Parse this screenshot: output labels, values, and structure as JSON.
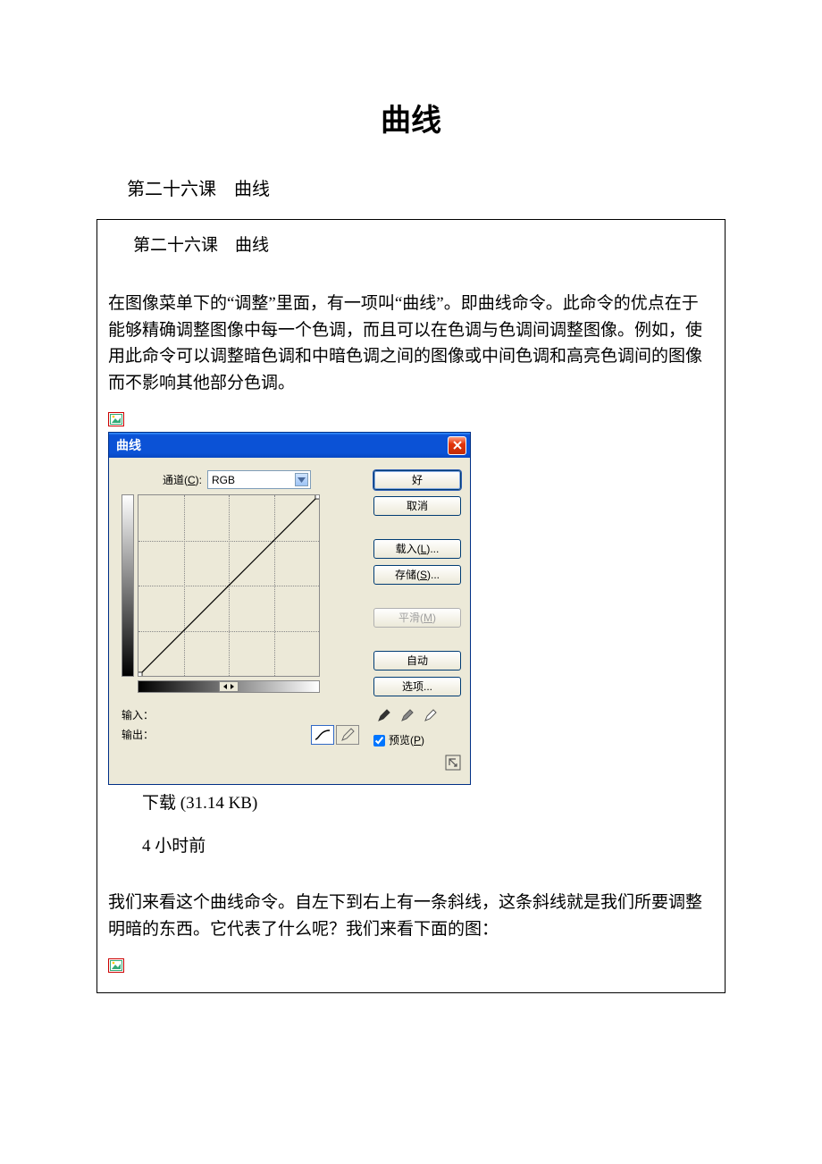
{
  "doc": {
    "title": "曲线",
    "lesson_heading": "第二十六课　曲线",
    "sub_heading": "第二十六课　曲线",
    "para1": "在图像菜单下的“调整”里面，有一项叫“曲线”。即曲线命令。此命令的优点在于能够精确调整图像中每一个色调，而且可以在色调与色调间调整图像。例如，使用此命令可以调整暗色调和中暗色调之间的图像或中间色调和高亮色调间的图像而不影响其他部分色调。",
    "download": "下载 (31.14 KB)",
    "time": "4 小时前",
    "para2": "我们来看这个曲线命令。自左下到右上有一条斜线，这条斜线就是我们所要调整明暗的东西。它代表了什么呢？我们来看下面的图："
  },
  "dialog": {
    "title": "曲线",
    "channel_label_prefix": "通道(",
    "channel_label_u": "C",
    "channel_label_suffix": "):",
    "channel_value": "RGB",
    "input_label": "输入：",
    "output_label": "输出：",
    "buttons": {
      "ok": "好",
      "cancel": "取消",
      "load_pre": "载入(",
      "load_u": "L",
      "load_suf": ")...",
      "save_pre": "存储(",
      "save_u": "S",
      "save_suf": ")...",
      "smooth_pre": "平滑(",
      "smooth_u": "M",
      "smooth_suf": ")",
      "auto": "自动",
      "options": "选项..."
    },
    "preview_pre": "预览(",
    "preview_u": "P",
    "preview_suf": ")"
  }
}
